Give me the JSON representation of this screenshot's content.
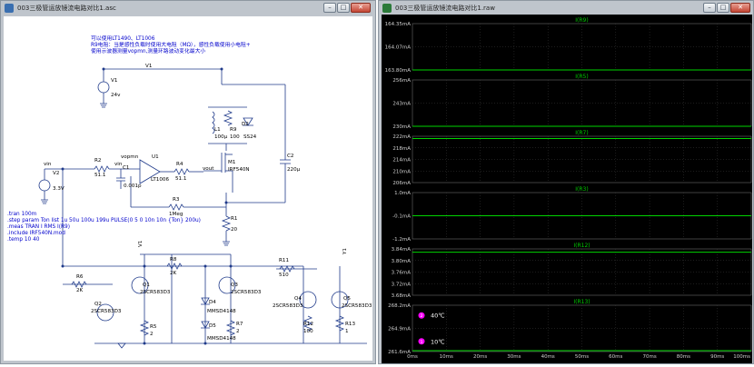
{
  "schematic_window": {
    "title": "003三极管运放镜流电路对比1.asc",
    "controls": {
      "minimize": "–",
      "maximize": "□",
      "close": "✕"
    }
  },
  "waveform_window": {
    "title": "003三极管运放镜流电路对比1.raw",
    "controls": {
      "minimize": "–",
      "maximize": "□",
      "close": "✕"
    }
  },
  "schematic": {
    "notes": [
      "可以使用LT1490、LT1006",
      "R9电阻：当是感性负载时使用大电阻（MΩ），感性负载使用小电阻+",
      "使用示波器测量vopmn,测量环路波动变化最大小"
    ],
    "directives": [
      ".tran 100m",
      ".step param Ton list 1u  50u 100u 199u",
      ".meas TRAN I RMS I(R9)",
      ".include IRF540N.mod",
      ".temp 10 40"
    ],
    "pulse": "PULSE(0 5 0 10n 10n {Ton} 200u)",
    "labels": {
      "v1": "V1",
      "v1_val": "24v",
      "v1_node": "V1",
      "v2": "V2",
      "v2_val": "3.3V",
      "vin": "vin",
      "r2": "R2",
      "r2_val": "51.1",
      "vin_label": "vin",
      "c1": "C1",
      "c1_val": "0.001p",
      "vopmn": "vopmn",
      "u1": "U1",
      "u1_val": "LT1006",
      "r4": "R4",
      "r4_val": "51.1",
      "vout": "vout",
      "m1": "M1",
      "m1_val": "IRF540N",
      "l1": "L1",
      "l1_val": "100µ",
      "r9": "R9",
      "r9_val": "100",
      "d2": "D2",
      "d2_val": "SS24",
      "c2": "C2",
      "c2_val": "220µ",
      "r3": "R3",
      "r3_val": "1Meg",
      "r1": "R1",
      "r1_val": "20",
      "v1_node2": "V1",
      "y1_node": "Y1",
      "r6": "R6",
      "r6_val": "2K",
      "r8": "R8",
      "r8_val": "2K",
      "r11": "R11",
      "r11_val": "510",
      "q1": "Q1",
      "q1_val": "2SCR583D3",
      "q2": "Q2",
      "q2_val": "2SCR583D3",
      "q3": "Q3",
      "q3_val": "2SCR583D3",
      "q4": "Q4",
      "q4_val": "2SCR583D3",
      "q5": "Q5",
      "q5_val": "2SCR583D3",
      "d4": "D4",
      "d4_val": "MMSD4148",
      "d5": "D5",
      "d5_val": "MMSD4148",
      "r5": "R5",
      "r5_val": "2",
      "r7": "R7",
      "r7_val": "2",
      "r12": "R12",
      "r12_val": "100",
      "r13": "R13",
      "r13_val": "1"
    }
  },
  "waveforms": {
    "colors": {
      "bg": "#000000",
      "grid": "#3a3a3a",
      "trace": "#00d400",
      "title": "#00cc00",
      "axis_text": "#cfcfcf",
      "legend": "#ff00ff"
    },
    "legend": [
      {
        "label": "40℃",
        "marker": "2"
      },
      {
        "label": "10℃",
        "marker": "1"
      }
    ],
    "x_axis": {
      "ticks": [
        "0ms",
        "10ms",
        "20ms",
        "30ms",
        "40ms",
        "50ms",
        "60ms",
        "70ms",
        "80ms",
        "90ms",
        "100ms"
      ]
    },
    "panes": [
      {
        "title": "I(R9)",
        "ticks": [
          "164.35mA",
          "164.07mA",
          "163.80mA"
        ],
        "trace_level": 0.0
      },
      {
        "title": "I(R5)",
        "ticks": [
          "256mA",
          "243mA",
          "230mA"
        ],
        "trace_level": 0.0
      },
      {
        "title": "I(R7)",
        "ticks": [
          "222mA",
          "218mA",
          "214mA",
          "210mA",
          "206mA"
        ],
        "trace_level": 0.95
      },
      {
        "title": "I(R3)",
        "ticks": [
          "1.0mA",
          "-0.1mA",
          "-1.2mA"
        ],
        "trace_level": 0.5
      },
      {
        "title": "I(R12)",
        "ticks": [
          "3.84mA",
          "3.80mA",
          "3.76mA",
          "3.72mA",
          "3.68mA"
        ],
        "trace_level": 0.93
      },
      {
        "title": "I(R13)",
        "ticks": [
          "268.2mA",
          "264.9mA",
          "261.6mA"
        ],
        "trace_level": 0.02
      }
    ]
  }
}
